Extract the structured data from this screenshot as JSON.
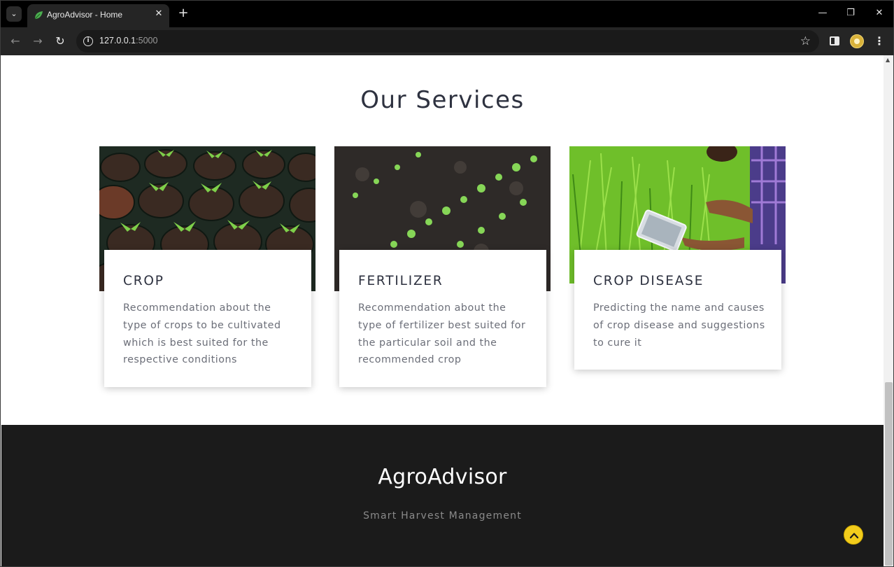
{
  "browser": {
    "tab_title": "AgroAdvisor - Home",
    "url_host": "127.0.0.1",
    "url_port": ":5000"
  },
  "services": {
    "heading": "Our Services",
    "cards": [
      {
        "title": "CROP",
        "description": "Recommendation about the type of crops to be cultivated which is best suited for the respective conditions",
        "image": "seedlings-in-pots"
      },
      {
        "title": "FERTILIZER",
        "description": "Recommendation about the type of fertilizer best suited for the particular soil and the recommended crop",
        "image": "sprouts-in-soil"
      },
      {
        "title": "CROP DISEASE",
        "description": "Predicting the name and causes of crop disease and suggestions to cure it",
        "image": "farmer-with-tablet-in-rice-field"
      }
    ]
  },
  "footer": {
    "brand": "AgroAdvisor",
    "tagline": "Smart Harvest Management"
  },
  "colors": {
    "heading": "#2e3240",
    "body_text": "#6b6e78",
    "footer_bg": "#1b1b1b",
    "accent_yellow": "#f2cc1c"
  }
}
